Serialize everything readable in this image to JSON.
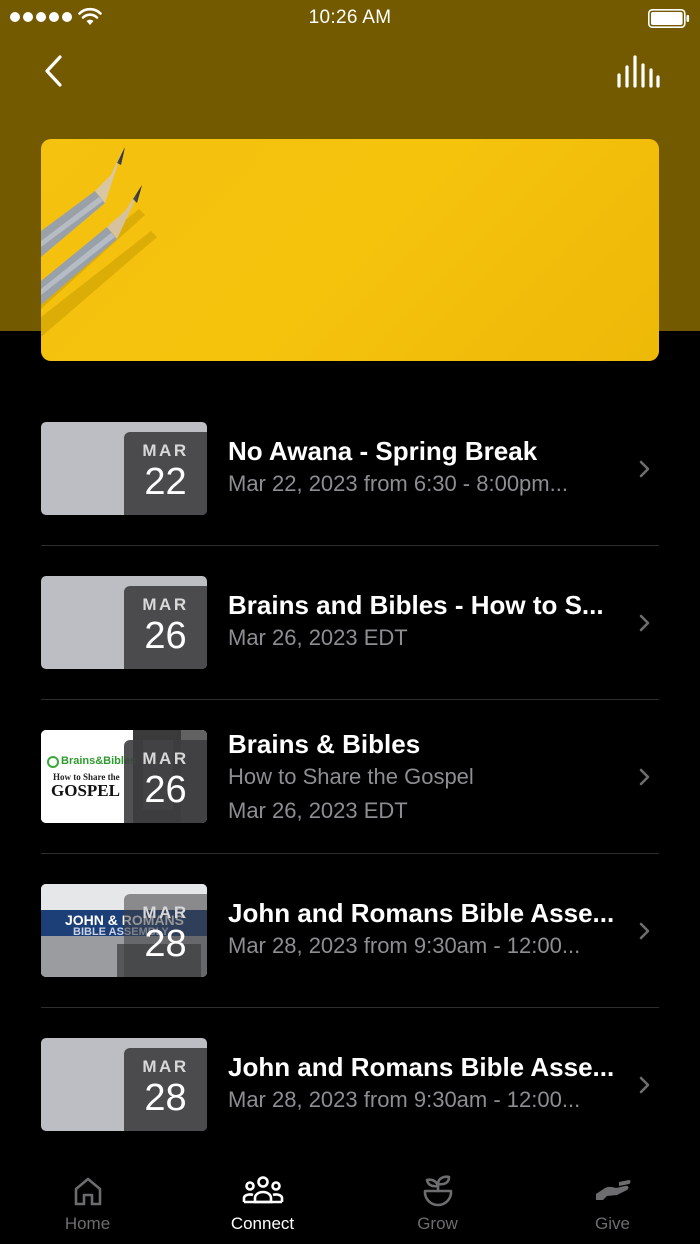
{
  "status_bar": {
    "time": "10:26 AM"
  },
  "nav": {
    "back_icon": "chevron-left-icon",
    "audio_icon": "audio-bars-icon"
  },
  "colors": {
    "header_bg": "#735a00",
    "hero_bg": "#f4c20f",
    "list_bg": "#000000",
    "subtitle": "#8d8d92"
  },
  "events": [
    {
      "month": "MAR",
      "day": "22",
      "title": "No Awana - Spring Break",
      "lines": [
        "Mar 22, 2023 from 6:30 - 8:00pm..."
      ]
    },
    {
      "month": "MAR",
      "day": "26",
      "title": "Brains and Bibles - How to S...",
      "lines": [
        "Mar 26, 2023 EDT"
      ]
    },
    {
      "month": "MAR",
      "day": "26",
      "title": "Brains & Bibles",
      "lines": [
        "How to Share the Gospel",
        "Mar 26, 2023 EDT"
      ],
      "thumb": {
        "brand": "Brains&Bibles",
        "line1": "How to Share the",
        "line2": "GOSPEL"
      }
    },
    {
      "month": "MAR",
      "day": "28",
      "title": "John and Romans Bible Asse...",
      "lines": [
        "Mar 28, 2023 from 9:30am - 12:00..."
      ],
      "thumb": {
        "line1": "JOHN & ROMANS",
        "line2": "BIBLE ASSEMBLY"
      }
    },
    {
      "month": "MAR",
      "day": "28",
      "title": "John and Romans Bible Asse...",
      "lines": [
        "Mar 28, 2023 from 9:30am - 12:00..."
      ]
    }
  ],
  "tabs": [
    {
      "label": "Home",
      "icon": "home-icon",
      "active": false
    },
    {
      "label": "Connect",
      "icon": "people-icon",
      "active": true
    },
    {
      "label": "Grow",
      "icon": "plant-icon",
      "active": false
    },
    {
      "label": "Give",
      "icon": "hand-icon",
      "active": false
    }
  ]
}
